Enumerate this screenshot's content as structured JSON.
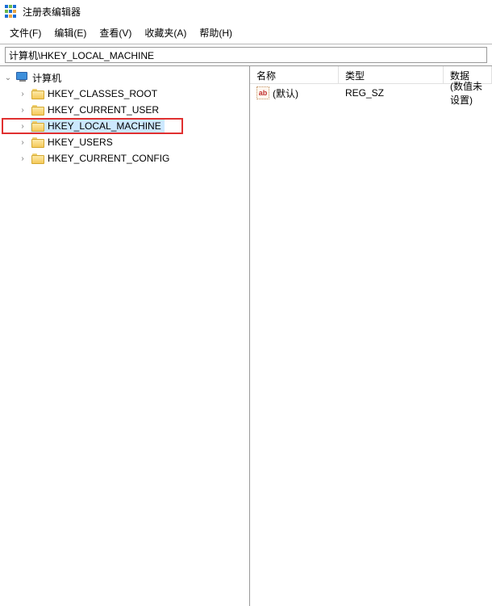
{
  "app": {
    "title": "注册表编辑器"
  },
  "menu": {
    "file": "文件(F)",
    "edit": "编辑(E)",
    "view": "查看(V)",
    "favorites": "收藏夹(A)",
    "help": "帮助(H)"
  },
  "address": {
    "value": "计算机\\HKEY_LOCAL_MACHINE"
  },
  "tree": {
    "root": "计算机",
    "items": [
      {
        "label": "HKEY_CLASSES_ROOT"
      },
      {
        "label": "HKEY_CURRENT_USER"
      },
      {
        "label": "HKEY_LOCAL_MACHINE"
      },
      {
        "label": "HKEY_USERS"
      },
      {
        "label": "HKEY_CURRENT_CONFIG"
      }
    ]
  },
  "columns": {
    "name": "名称",
    "type": "类型",
    "data": "数据"
  },
  "values": [
    {
      "icon": "ab",
      "name": "(默认)",
      "type": "REG_SZ",
      "data": "(数值未设置)"
    }
  ]
}
